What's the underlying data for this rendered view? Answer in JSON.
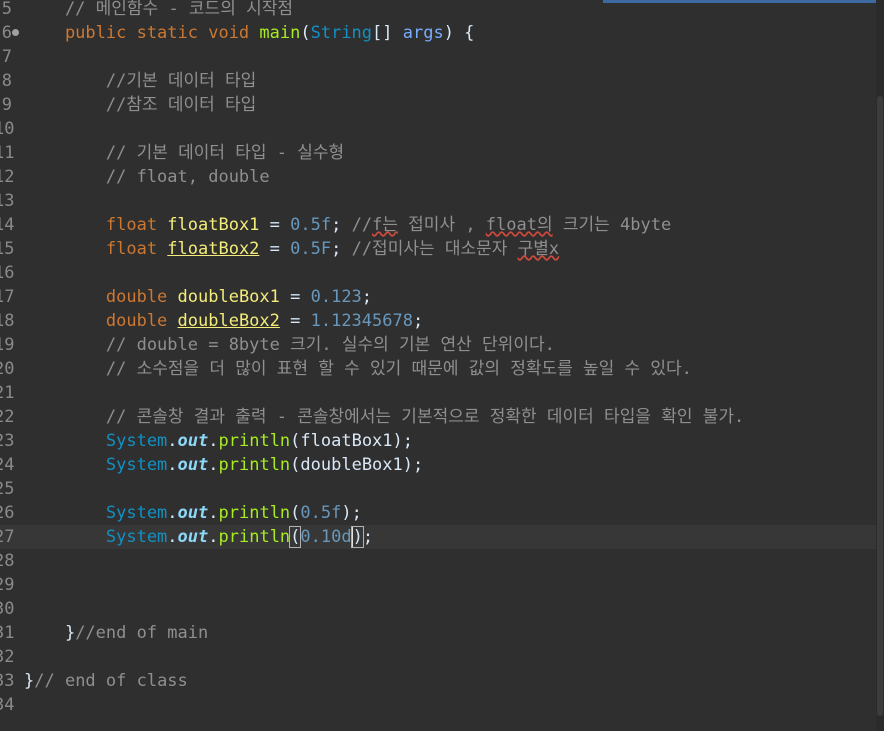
{
  "editor": {
    "lines": [
      {
        "n": "5",
        "tokens": [
          [
            "cm",
            "    // 메인함수 - 코드의 시작점"
          ]
        ]
      },
      {
        "n": "6",
        "fold": true,
        "tokens": [
          [
            "kw",
            "    public static void "
          ],
          [
            "fn",
            "main"
          ],
          [
            "pl",
            "("
          ],
          [
            "ty",
            "String"
          ],
          [
            "pl",
            "[] "
          ],
          [
            "par",
            "args"
          ],
          [
            "pl",
            ") {"
          ]
        ]
      },
      {
        "n": "7",
        "tokens": []
      },
      {
        "n": "8",
        "tokens": [
          [
            "cm",
            "        //기본 데이터 타입"
          ]
        ]
      },
      {
        "n": "9",
        "tokens": [
          [
            "cm",
            "        //참조 데이터 타입"
          ]
        ]
      },
      {
        "n": "10",
        "tokens": []
      },
      {
        "n": "11",
        "tokens": [
          [
            "cm",
            "        // 기본 데이터 타입 - 실수형"
          ]
        ]
      },
      {
        "n": "12",
        "tokens": [
          [
            "cm",
            "        // float, double"
          ]
        ]
      },
      {
        "n": "13",
        "tokens": []
      },
      {
        "n": "14",
        "tokens": [
          [
            "kw",
            "        float "
          ],
          [
            "var",
            "floatBox1"
          ],
          [
            "pl",
            " = "
          ],
          [
            "num",
            "0.5f"
          ],
          [
            "pl",
            "; "
          ],
          [
            "cm",
            "//"
          ],
          [
            "cm squig",
            "f는"
          ],
          [
            "cm",
            " 접미사 , "
          ],
          [
            "cm squig",
            "float의"
          ],
          [
            "cm",
            " 크기는 4byte"
          ]
        ]
      },
      {
        "n": "15",
        "tokens": [
          [
            "kw",
            "        float "
          ],
          [
            "var uline",
            "floatBox2"
          ],
          [
            "pl",
            " = "
          ],
          [
            "num",
            "0.5F"
          ],
          [
            "pl",
            "; "
          ],
          [
            "cm",
            "//접미사는 대소문자 "
          ],
          [
            "cm squig",
            "구별x"
          ]
        ]
      },
      {
        "n": "16",
        "tokens": []
      },
      {
        "n": "17",
        "tokens": [
          [
            "kw",
            "        double "
          ],
          [
            "var",
            "doubleBox1"
          ],
          [
            "pl",
            " = "
          ],
          [
            "num",
            "0.123"
          ],
          [
            "pl",
            ";"
          ]
        ]
      },
      {
        "n": "18",
        "tokens": [
          [
            "kw",
            "        double "
          ],
          [
            "var uline",
            "doubleBox2"
          ],
          [
            "pl",
            " = "
          ],
          [
            "num",
            "1.12345678"
          ],
          [
            "pl",
            ";"
          ]
        ]
      },
      {
        "n": "19",
        "tokens": [
          [
            "cm",
            "        // double = 8byte 크기. 실수의 기본 연산 단위이다."
          ]
        ]
      },
      {
        "n": "20",
        "tokens": [
          [
            "cm",
            "        // 소수점을 더 많이 표현 할 수 있기 때문에 값의 정확도를 높일 수 있다."
          ]
        ]
      },
      {
        "n": "21",
        "tokens": []
      },
      {
        "n": "22",
        "tokens": [
          [
            "cm",
            "        // 콘솔창 결과 출력 - 콘솔창에서는 기본적으로 정확한 데이터 타입을 확인 불가."
          ]
        ]
      },
      {
        "n": "23",
        "tokens": [
          [
            "ty",
            "        System"
          ],
          [
            "pl",
            "."
          ],
          [
            "out",
            "out"
          ],
          [
            "pl",
            "."
          ],
          [
            "mth",
            "println"
          ],
          [
            "pl",
            "(floatBox1);"
          ]
        ]
      },
      {
        "n": "24",
        "tokens": [
          [
            "ty",
            "        System"
          ],
          [
            "pl",
            "."
          ],
          [
            "out",
            "out"
          ],
          [
            "pl",
            "."
          ],
          [
            "mth",
            "println"
          ],
          [
            "pl",
            "(doubleBox1);"
          ]
        ]
      },
      {
        "n": "25",
        "tokens": []
      },
      {
        "n": "26",
        "tokens": [
          [
            "ty",
            "        System"
          ],
          [
            "pl",
            "."
          ],
          [
            "out",
            "out"
          ],
          [
            "pl",
            "."
          ],
          [
            "mth",
            "println"
          ],
          [
            "pl",
            "("
          ],
          [
            "num",
            "0.5f"
          ],
          [
            "pl",
            ");"
          ]
        ]
      },
      {
        "n": "27",
        "current": true,
        "tokens": [
          [
            "ty",
            "        System"
          ],
          [
            "pl",
            "."
          ],
          [
            "out",
            "out"
          ],
          [
            "pl",
            "."
          ],
          [
            "mth",
            "println"
          ],
          [
            "pl bracket",
            "("
          ],
          [
            "num",
            "0.10d"
          ],
          [
            "pl bracket caret",
            ")"
          ],
          [
            "pl",
            ";"
          ]
        ]
      },
      {
        "n": "28",
        "tokens": []
      },
      {
        "n": "29",
        "tokens": []
      },
      {
        "n": "30",
        "tokens": []
      },
      {
        "n": "31",
        "tokens": [
          [
            "pl",
            "    }"
          ],
          [
            "cm",
            "//end of main"
          ]
        ]
      },
      {
        "n": "32",
        "tokens": []
      },
      {
        "n": "33",
        "tokens": [
          [
            "pl",
            "}"
          ],
          [
            "cm",
            "// end of class"
          ]
        ]
      },
      {
        "n": "34",
        "tokens": []
      }
    ]
  }
}
